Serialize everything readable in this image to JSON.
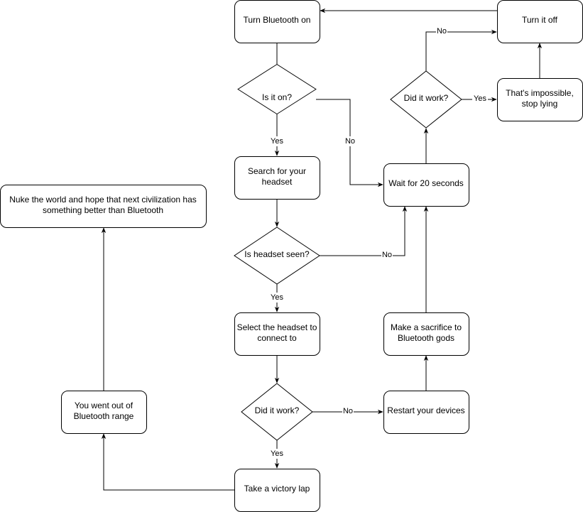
{
  "nodes": {
    "turn_on": [
      "Turn Bluetooth on"
    ],
    "is_on": [
      "Is it on?"
    ],
    "search": [
      "Search for your",
      "headset"
    ],
    "seen": [
      "Is headset seen?"
    ],
    "select": [
      "Select the headset to",
      "connect to"
    ],
    "worked_bottom": [
      "Did it work?"
    ],
    "victory": [
      "Take a victory lap"
    ],
    "restart": [
      "Restart your devices"
    ],
    "sacrifice": [
      "Make a sacrifice to",
      "Bluetooth gods"
    ],
    "wait": [
      "Wait for 20 seconds"
    ],
    "worked_top": [
      "Did it work?"
    ],
    "impossible": [
      "That's impossible,",
      "stop lying"
    ],
    "turn_off": [
      "Turn it off"
    ],
    "range": [
      "You went out of",
      "Bluetooth range"
    ],
    "nuke": [
      "Nuke the world and hope that next civilization has",
      "something better than Bluetooth"
    ]
  },
  "edge_labels": {
    "is_on_no": "No",
    "is_on_yes": "Yes",
    "seen_no": "No",
    "seen_yes": "Yes",
    "worked_bottom_no": "No",
    "worked_bottom_yes": "Yes",
    "worked_top_no": "No",
    "worked_top_yes": "Yes"
  }
}
